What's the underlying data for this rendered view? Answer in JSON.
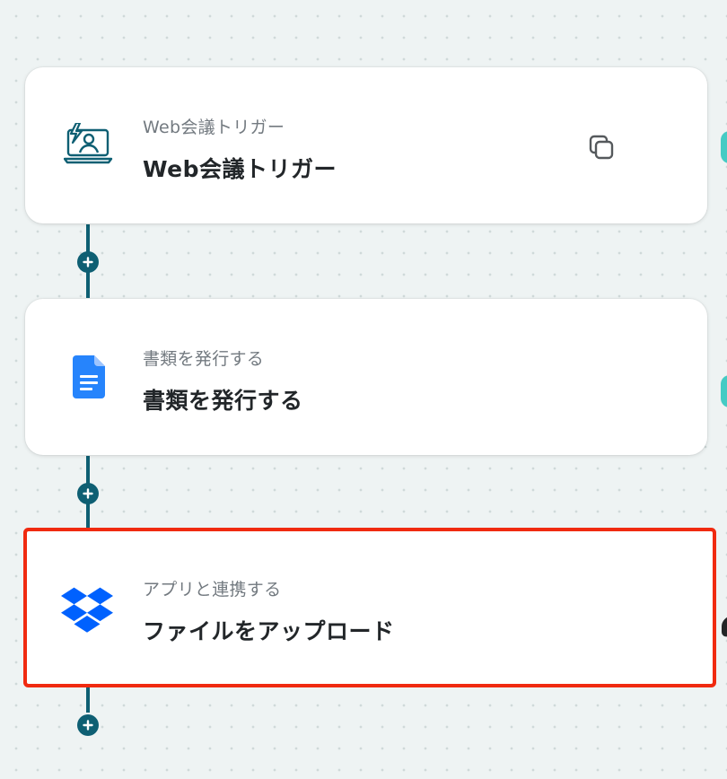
{
  "flow": {
    "steps": [
      {
        "subtitle": "Web会議トリガー",
        "title": "Web会議トリガー",
        "icon": "video-meeting-trigger-icon",
        "has_copy_button": true
      },
      {
        "subtitle": "書類を発行する",
        "title": "書類を発行する",
        "icon": "google-docs-icon"
      },
      {
        "subtitle": "アプリと連携する",
        "title": "ファイルをアップロード",
        "icon": "dropbox-icon",
        "selected": true
      }
    ],
    "add_step_icon": "plus-icon",
    "copy_icon": "copy-icon"
  },
  "colors": {
    "connector": "#0e5f73",
    "selection_border": "#f02a10",
    "dropbox_blue": "#0061fe",
    "docs_blue": "#2684fc",
    "teal_accent": "#45cbc4"
  }
}
